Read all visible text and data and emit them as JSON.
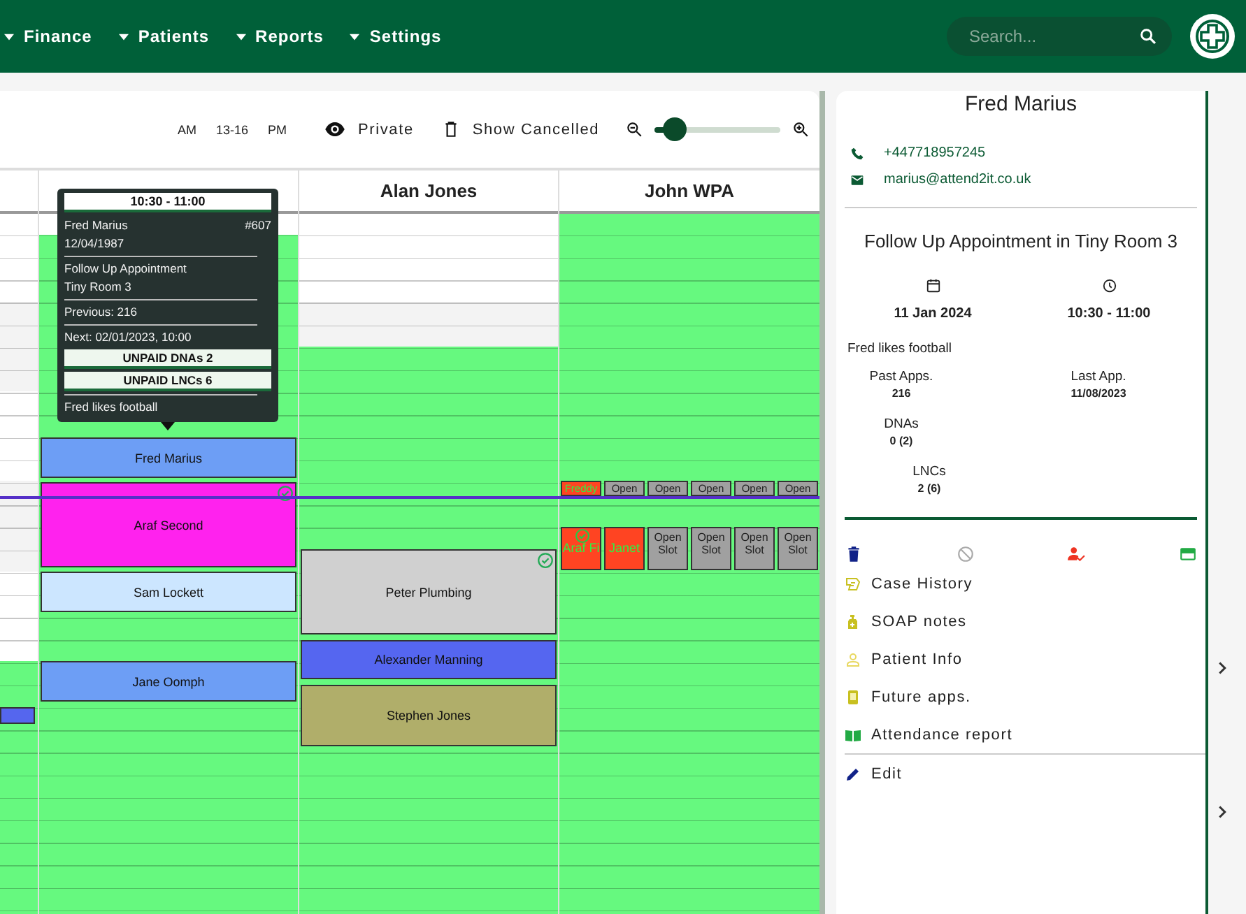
{
  "nav": {
    "menu": [
      {
        "label": "Finance"
      },
      {
        "label": "Patients"
      },
      {
        "label": "Reports"
      },
      {
        "label": "Settings"
      }
    ],
    "search": {
      "placeholder": "Search..."
    }
  },
  "toolbar": {
    "ranges": [
      "AM",
      "13-16",
      "PM"
    ],
    "private_label": "Private",
    "cancelled_label": "Show Cancelled",
    "zoom": {
      "level": 0.15
    }
  },
  "calendar": {
    "columns": [
      {
        "appointments": [
          {
            "color": "#5566ee"
          }
        ]
      },
      {
        "appointments": [
          {
            "patient": "Fred Marius",
            "color": "#6d9ef5",
            "checked": false
          },
          {
            "patient": "Araf Second",
            "color": "#ff22ee",
            "checked": true
          },
          {
            "patient": "Sam Lockett",
            "color": "#cce6ff",
            "checked": false
          },
          {
            "patient": "Jane Oomph",
            "color": "#6d9ef5",
            "checked": false
          }
        ]
      },
      {
        "name": "Alan Jones",
        "appointments": [
          {
            "patient": "Peter Plumbing",
            "color": "#d0d0d0",
            "checked": true
          },
          {
            "patient": "Alexander Manning",
            "color": "#5566f0",
            "checked": false
          },
          {
            "patient": "Stephen Jones",
            "color": "#b0ae6a",
            "checked": false
          }
        ]
      },
      {
        "name": "John WPA",
        "slot_rows": [
          [
            {
              "kind": "booked",
              "label": "Freddy",
              "checked": false
            },
            {
              "kind": "open",
              "label": "Open"
            },
            {
              "kind": "open",
              "label": "Open"
            },
            {
              "kind": "open",
              "label": "Open"
            },
            {
              "kind": "open",
              "label": "Open"
            },
            {
              "kind": "open",
              "label": "Open"
            }
          ],
          [
            {
              "kind": "booked",
              "label": "Araf Fi",
              "checked": true
            },
            {
              "kind": "booked",
              "label": "Janet",
              "checked": false
            },
            {
              "kind": "open",
              "label": "Open Slot"
            },
            {
              "kind": "open",
              "label": "Open Slot"
            },
            {
              "kind": "open",
              "label": "Open Slot"
            },
            {
              "kind": "open",
              "label": "Open Slot"
            }
          ]
        ]
      }
    ]
  },
  "tooltip": {
    "time": "10:30 - 11:00",
    "patient": "Fred Marius",
    "number": "#607",
    "dob": "12/04/1987",
    "type": "Follow Up Appointment",
    "room": "Tiny Room 3",
    "previous": "Previous: 216",
    "next": "Next: 02/01/2023, 10:00",
    "badges": [
      "UNPAID DNAs 2",
      "UNPAID LNCs 6"
    ],
    "note": "Fred likes football"
  },
  "details": {
    "name": "Fred Marius",
    "phone": "+447718957245",
    "email": "marius@attend2it.co.uk",
    "title": "Follow Up Appointment in Tiny Room 3",
    "date": "11 Jan 2024",
    "time": "10:30 - 11:00",
    "note": "Fred likes football",
    "stats": [
      {
        "label": "Past Apps.",
        "value": "216"
      },
      {
        "label": "Last App.",
        "value": "11/08/2023"
      },
      {
        "label": "DNAs",
        "value": "0 (2)"
      },
      {
        "label": "LNCs",
        "value": "2 (6)"
      }
    ],
    "menu": [
      {
        "kind": "case",
        "label": "Case History"
      },
      {
        "kind": "soap",
        "label": "SOAP notes"
      },
      {
        "kind": "info",
        "label": "Patient Info"
      },
      {
        "kind": "future",
        "label": "Future apps."
      },
      {
        "kind": "report",
        "label": "Attendance report"
      },
      {
        "kind": "edit",
        "label": "Edit"
      }
    ]
  }
}
